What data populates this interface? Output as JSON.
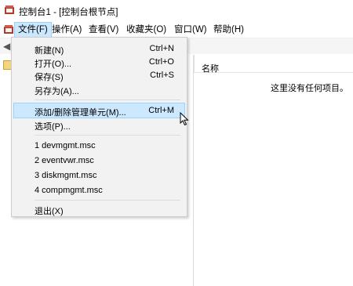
{
  "window": {
    "title": "控制台1 - [控制台根节点]"
  },
  "menubar": {
    "items": [
      {
        "label": "文件(F)",
        "active": true
      },
      {
        "label": "操作(A)"
      },
      {
        "label": "查看(V)"
      },
      {
        "label": "收藏夹(O)"
      },
      {
        "label": "窗口(W)"
      },
      {
        "label": "帮助(H)"
      }
    ]
  },
  "file_menu": {
    "items": [
      {
        "label": "新建(N)",
        "shortcut": "Ctrl+N"
      },
      {
        "label": "打开(O)...",
        "shortcut": "Ctrl+O"
      },
      {
        "label": "保存(S)",
        "shortcut": "Ctrl+S"
      },
      {
        "label": "另存为(A)...",
        "shortcut": ""
      },
      {
        "label": "添加/删除管理单元(M)...",
        "shortcut": "Ctrl+M",
        "highlighted": true
      },
      {
        "label": "选项(P)...",
        "shortcut": ""
      },
      {
        "label": "1 devmgmt.msc",
        "shortcut": ""
      },
      {
        "label": "2 eventvwr.msc",
        "shortcut": ""
      },
      {
        "label": "3 diskmgmt.msc",
        "shortcut": ""
      },
      {
        "label": "4 compmgmt.msc",
        "shortcut": ""
      },
      {
        "label": "退出(X)",
        "shortcut": ""
      }
    ]
  },
  "right_pane": {
    "column_name": "名称",
    "empty_message": "这里没有任何项目。"
  },
  "icons": {
    "app": "mmc-console-icon",
    "folder": "folder-icon",
    "back": "back-arrow-icon",
    "cursor": "mouse-pointer-icon"
  },
  "colors": {
    "highlight_bg": "#cce8ff",
    "highlight_border": "#99d1ff",
    "menu_bg": "#f2f2f2"
  }
}
